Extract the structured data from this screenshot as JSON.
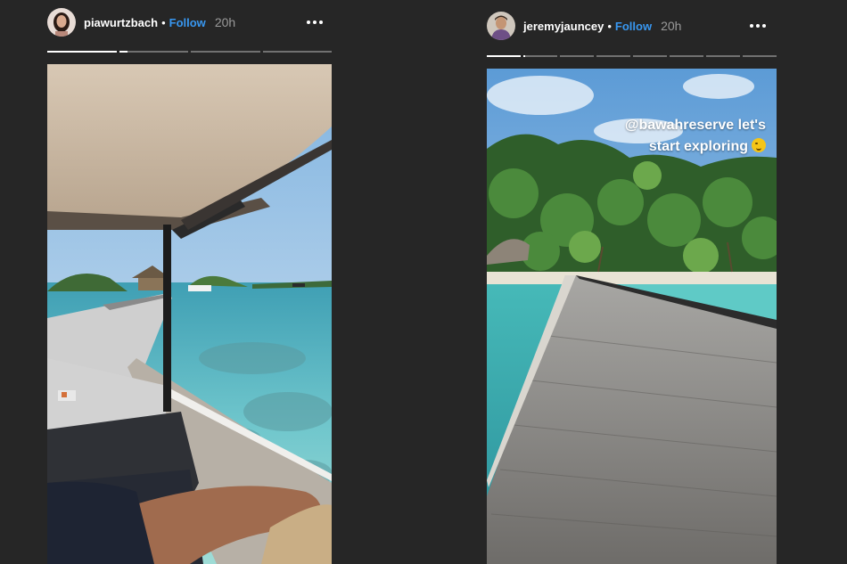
{
  "stories": [
    {
      "username": "piawurtzbach",
      "separator": "•",
      "follow_label": "Follow",
      "time": "20h",
      "avatar_icon": "profile-photo",
      "more_icon": "more-options-icon",
      "progress": {
        "segments": 4,
        "current_index": 0,
        "current_fill": 1.0,
        "next_fill": 0.12
      },
      "media": "photo: view from golf cart onto wooden boardwalk over turquoise sea"
    },
    {
      "username": "jeremyjauncey",
      "separator": "•",
      "follow_label": "Follow",
      "time": "20h",
      "avatar_icon": "profile-photo",
      "more_icon": "more-options-icon",
      "progress": {
        "segments": 8,
        "current_index": 0,
        "current_fill": 1.0,
        "next_fill": 0.05
      },
      "caption_line1": "@bawahreserve let's",
      "caption_line2": "start exploring",
      "media": "photo: long wooden jetty leading to tropical island"
    }
  ],
  "colors": {
    "background": "#262626",
    "follow": "#3897f0",
    "time": "#9a9a9a"
  }
}
